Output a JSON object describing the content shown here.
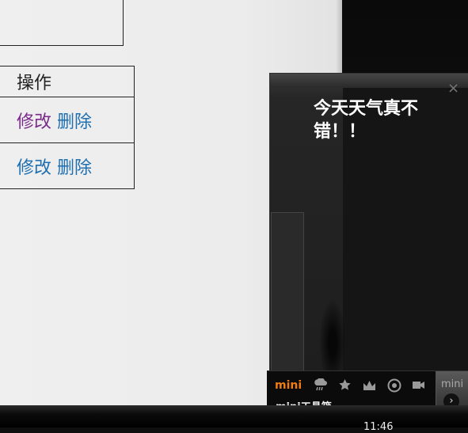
{
  "table": {
    "header": "操作",
    "rows": [
      {
        "edit": "修改",
        "delete": "删除"
      },
      {
        "edit": "修改",
        "delete": "删除"
      }
    ]
  },
  "widget": {
    "close": "×",
    "message": "今天天气真不错！！"
  },
  "toolbar": {
    "brand": "mini",
    "caption": "mini工具箱",
    "icons": [
      "weather-icon",
      "star-icon",
      "crown-icon",
      "target-icon",
      "camera-icon"
    ],
    "tab_text": "mini",
    "arrow": "›"
  },
  "taskbar": {
    "clock": "11:46"
  },
  "colors": {
    "visited_link": "#7a2a8a",
    "link": "#1f6fb0",
    "brand": "#f07c12"
  }
}
